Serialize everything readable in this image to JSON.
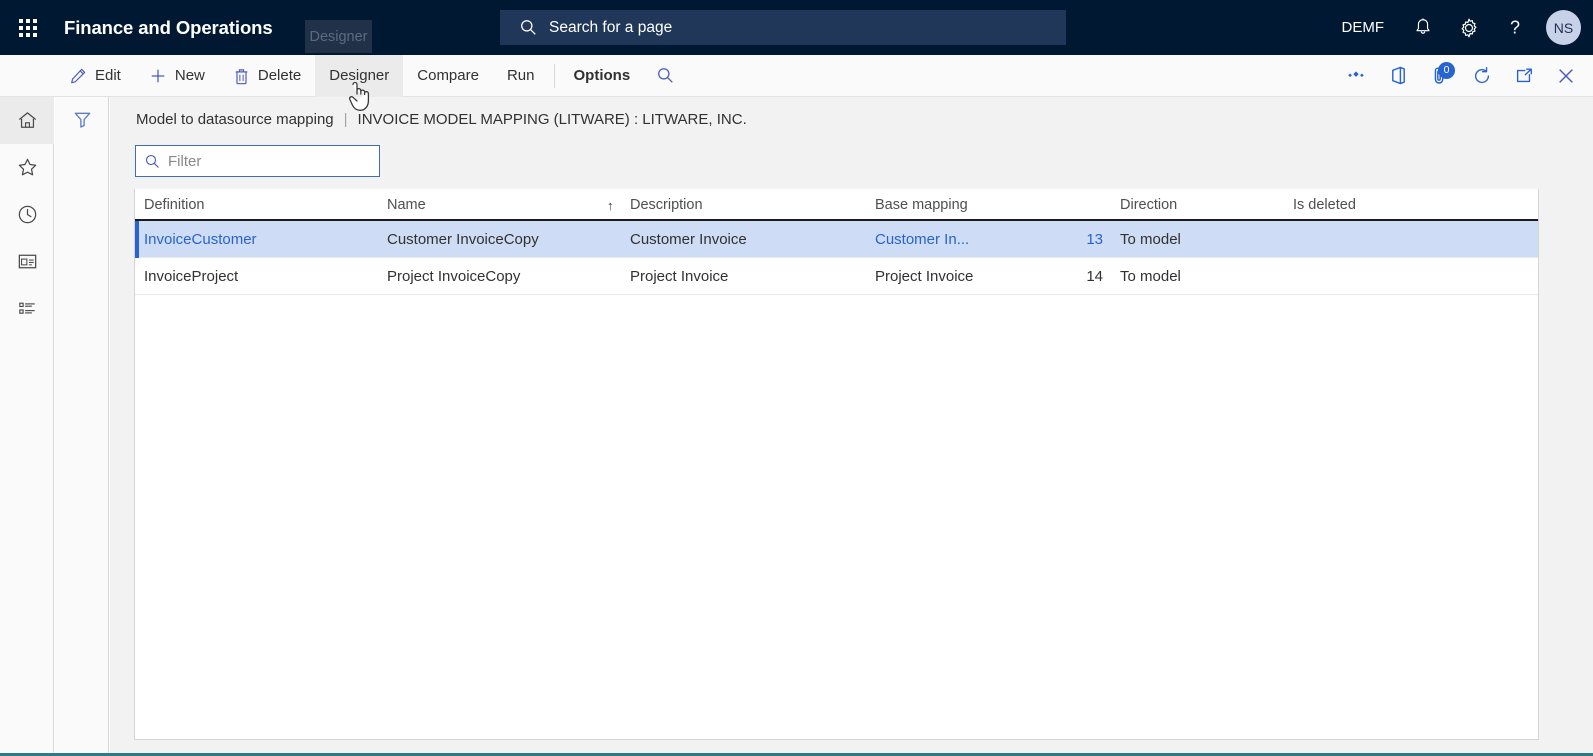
{
  "header": {
    "app_title": "Finance and Operations",
    "waffle_icon": "app-launcher-grid-icon",
    "search": {
      "icon": "search-icon",
      "placeholder": "Search for a page"
    },
    "company": "DEMF",
    "icons": [
      {
        "name": "notifications-bell-icon",
        "glyph": "bell"
      },
      {
        "name": "settings-gear-icon",
        "glyph": "gear"
      },
      {
        "name": "help-question-icon",
        "glyph": "question"
      }
    ],
    "avatar_initials": "NS"
  },
  "tooltip": {
    "text": "Designer"
  },
  "toolbar": {
    "buttons": [
      {
        "name": "edit-button",
        "label": "Edit",
        "icon": "pencil-icon",
        "bold": false,
        "hovered": false
      },
      {
        "name": "new-button",
        "label": "New",
        "icon": "plus-icon",
        "bold": false,
        "hovered": false
      },
      {
        "name": "delete-button",
        "label": "Delete",
        "icon": "trash-icon",
        "bold": false,
        "hovered": false
      },
      {
        "name": "designer-button",
        "label": "Designer",
        "icon": "",
        "bold": false,
        "hovered": true
      },
      {
        "name": "compare-button",
        "label": "Compare",
        "icon": "",
        "bold": false,
        "hovered": false
      },
      {
        "name": "run-button",
        "label": "Run",
        "icon": "",
        "bold": false,
        "hovered": false
      },
      {
        "name": "options-button",
        "label": "Options",
        "icon": "",
        "bold": true,
        "hovered": false
      }
    ],
    "search_icon": "search-icon",
    "right_icons": [
      {
        "name": "power-bi-flow-icon",
        "glyph": "diamonds",
        "badge": null
      },
      {
        "name": "office-app-icon",
        "glyph": "office",
        "badge": null
      },
      {
        "name": "attachments-icon",
        "glyph": "clip",
        "badge": "0"
      },
      {
        "name": "refresh-icon",
        "glyph": "refresh",
        "badge": null
      },
      {
        "name": "open-in-new-icon",
        "glyph": "popout",
        "badge": null
      },
      {
        "name": "close-page-icon",
        "glyph": "close",
        "badge": null
      }
    ]
  },
  "nav_rail": {
    "hamburger_icon": "hamburger-menu-icon",
    "items": [
      {
        "name": "nav-home",
        "icon": "home-icon",
        "active": true
      },
      {
        "name": "nav-favorites",
        "icon": "star-icon",
        "active": false
      },
      {
        "name": "nav-recent",
        "icon": "clock-icon",
        "active": false
      },
      {
        "name": "nav-workspaces",
        "icon": "workspace-icon",
        "active": false
      },
      {
        "name": "nav-modules",
        "icon": "list-icon",
        "active": false
      }
    ]
  },
  "filter_rail": {
    "icon": "funnel-filter-icon"
  },
  "page": {
    "breadcrumb_link": "Model to datasource mapping",
    "breadcrumb_divider": "|",
    "breadcrumb_caption": "INVOICE MODEL MAPPING (LITWARE) : LITWARE, INC.",
    "filter": {
      "icon": "search-icon",
      "placeholder": "Filter",
      "value": ""
    }
  },
  "grid": {
    "columns": [
      {
        "name": "col-definition",
        "label": "Definition",
        "sort": ""
      },
      {
        "name": "col-name",
        "label": "Name",
        "sort": "↑"
      },
      {
        "name": "col-description",
        "label": "Description",
        "sort": ""
      },
      {
        "name": "col-base-mapping",
        "label": "Base mapping",
        "sort": ""
      },
      {
        "name": "col-direction",
        "label": "Direction",
        "sort": ""
      },
      {
        "name": "col-is-deleted",
        "label": "Is deleted",
        "sort": ""
      }
    ],
    "rows": [
      {
        "selected": true,
        "definition": "InvoiceCustomer",
        "name": "Customer InvoiceCopy",
        "description": "Customer Invoice",
        "base_mapping": "Customer In...",
        "number": "13",
        "direction": "To model",
        "is_deleted": ""
      },
      {
        "selected": false,
        "definition": "InvoiceProject",
        "name": "Project InvoiceCopy",
        "description": "Project Invoice",
        "base_mapping": "Project Invoice",
        "number": "14",
        "direction": "To model",
        "is_deleted": ""
      }
    ]
  },
  "colors": {
    "header_bg": "#001832",
    "accent_link": "#2764cf",
    "selected_row": "#cfdcf5",
    "bottom_bar": "#2c7a86"
  }
}
